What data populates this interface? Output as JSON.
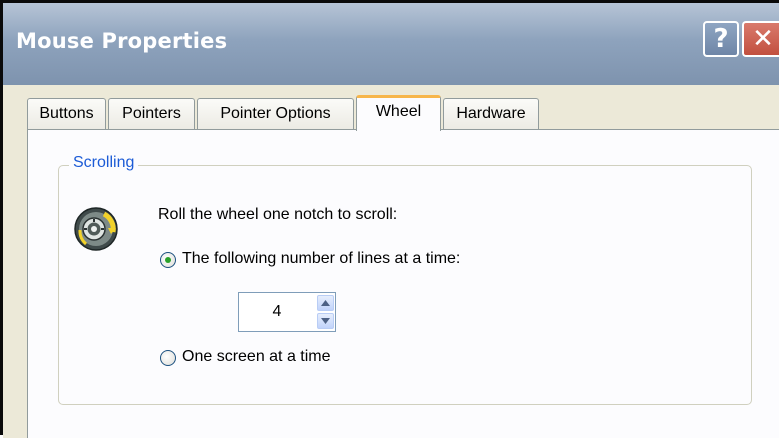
{
  "window": {
    "title": "Mouse Properties",
    "help_glyph": "?",
    "close_glyph": "✕"
  },
  "tabs": [
    {
      "label": "Buttons",
      "active": false
    },
    {
      "label": "Pointers",
      "active": false
    },
    {
      "label": "Pointer Options",
      "active": false
    },
    {
      "label": "Wheel",
      "active": true
    },
    {
      "label": "Hardware",
      "active": false
    }
  ],
  "scrolling": {
    "group_label": "Scrolling",
    "icon": "mouse-wheel-icon",
    "prompt": "Roll the wheel one notch to scroll:",
    "option_lines": {
      "label": "The following number of lines at a time:",
      "selected": true
    },
    "lines_value": "4",
    "option_screen": {
      "label": "One screen at a time",
      "selected": false
    }
  },
  "colors": {
    "group_label": "#1c5bd6",
    "active_tab_accent": "#f7b64b",
    "radio_dot": "#2aa12a"
  }
}
